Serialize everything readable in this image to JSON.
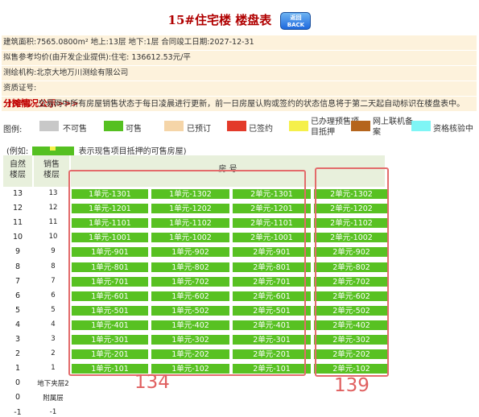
{
  "title": "15#住宅楼 楼盘表",
  "back_button": {
    "top": "返回",
    "bottom": "BACK"
  },
  "info": {
    "line1": "建筑面积:7565.0800m² 地上:13层 地下:1层 合同竣工日期:2027-12-31",
    "line2": "拟售参考均价(由开发企业提供):住宅: 136612.53元/平",
    "line3": "测绘机构:北京大地万川测绘有限公司",
    "line4": "资质证号:",
    "line5": "分摊情况公示>>>"
  },
  "note": {
    "bracket": "【说明】",
    "text": "交易网中所有房屋销售状态于每日凌晨进行更新，前一日房屋认购或签约的状态信息将于第二天起自动标识在楼盘表中。"
  },
  "legend": {
    "label": "图例:",
    "items": [
      {
        "text": "不可售",
        "color": "#c8c8c8"
      },
      {
        "text": "可售",
        "color": "#55c021"
      },
      {
        "text": "已预订",
        "color": "#f5d5a8"
      },
      {
        "text": "已签约",
        "color": "#e33a2a"
      },
      {
        "text": "已办理预售项目抵押",
        "color": "#f5f04a"
      },
      {
        "text": "网上联机备案",
        "color": "#b5651d"
      },
      {
        "text": "资格核验中",
        "color": "#7ff5f5"
      }
    ]
  },
  "example": {
    "prefix": "(例如:",
    "suffix": "表示现售项目抵押的可售房屋)"
  },
  "table": {
    "h_nat": "自然楼层",
    "h_sale": "销售楼层",
    "h_room": "房 号",
    "floors": [
      {
        "nat": "13",
        "sale": "13",
        "rooms": [
          "1单元-1301",
          "1单元-1302",
          "2单元-1301",
          "2单元-1302"
        ]
      },
      {
        "nat": "12",
        "sale": "12",
        "rooms": [
          "1单元-1201",
          "1单元-1202",
          "2单元-1201",
          "2单元-1202"
        ]
      },
      {
        "nat": "11",
        "sale": "11",
        "rooms": [
          "1单元-1101",
          "1单元-1102",
          "2单元-1101",
          "2单元-1102"
        ]
      },
      {
        "nat": "10",
        "sale": "10",
        "rooms": [
          "1单元-1001",
          "1单元-1002",
          "2单元-1001",
          "2单元-1002"
        ]
      },
      {
        "nat": "9",
        "sale": "9",
        "rooms": [
          "1单元-901",
          "1单元-902",
          "2单元-901",
          "2单元-902"
        ]
      },
      {
        "nat": "8",
        "sale": "8",
        "rooms": [
          "1单元-801",
          "1单元-802",
          "2单元-801",
          "2单元-802"
        ]
      },
      {
        "nat": "7",
        "sale": "7",
        "rooms": [
          "1单元-701",
          "1单元-702",
          "2单元-701",
          "2单元-702"
        ]
      },
      {
        "nat": "6",
        "sale": "6",
        "rooms": [
          "1单元-601",
          "1单元-602",
          "2单元-601",
          "2单元-602"
        ]
      },
      {
        "nat": "5",
        "sale": "5",
        "rooms": [
          "1单元-501",
          "1单元-502",
          "2单元-501",
          "2单元-502"
        ]
      },
      {
        "nat": "4",
        "sale": "4",
        "rooms": [
          "1单元-401",
          "1单元-402",
          "2单元-401",
          "2单元-402"
        ]
      },
      {
        "nat": "3",
        "sale": "3",
        "rooms": [
          "1单元-301",
          "1单元-302",
          "2单元-301",
          "2单元-302"
        ]
      },
      {
        "nat": "2",
        "sale": "2",
        "rooms": [
          "1单元-201",
          "1单元-202",
          "2单元-201",
          "2单元-202"
        ]
      },
      {
        "nat": "1",
        "sale": "1",
        "rooms": [
          "1单元-101",
          "1单元-102",
          "2单元-101",
          "2单元-102"
        ]
      },
      {
        "nat": "0",
        "sale": "地下夹层2",
        "rooms": []
      },
      {
        "nat": "0",
        "sale": "附属层",
        "rooms": []
      },
      {
        "nat": "-1",
        "sale": "-1",
        "rooms": []
      }
    ]
  },
  "annotations": {
    "left_count": "134",
    "right_count": "139"
  }
}
